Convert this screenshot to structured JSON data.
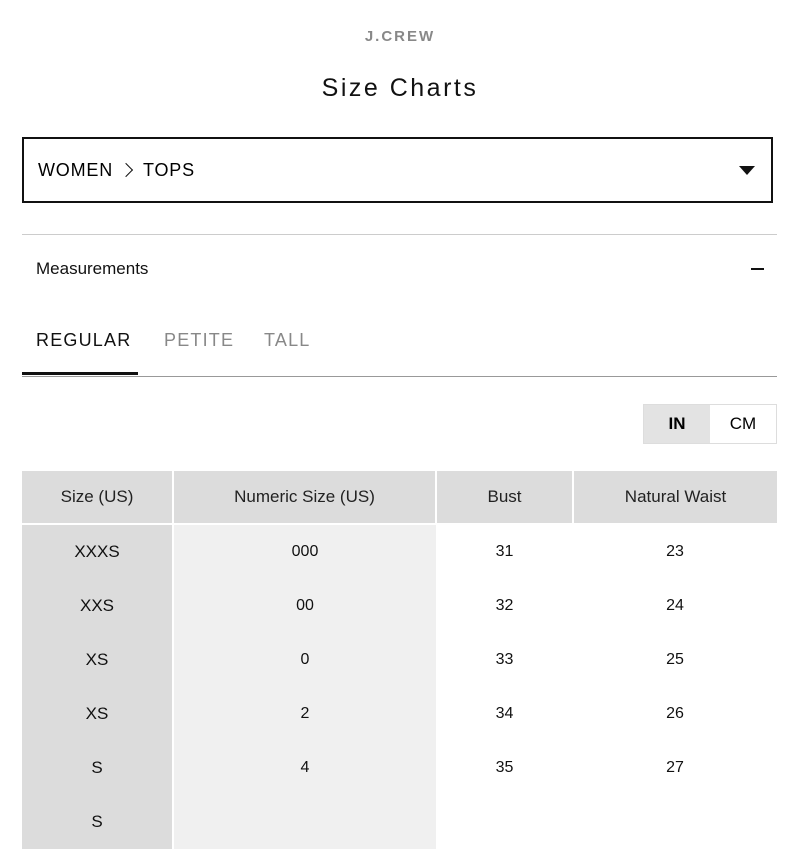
{
  "brand": "J.CREW",
  "page_title": "Size Charts",
  "category": {
    "level1": "WOMEN",
    "level2": "TOPS"
  },
  "accordion": {
    "label": "Measurements"
  },
  "tabs": [
    {
      "label": "REGULAR",
      "active": true
    },
    {
      "label": "PETITE",
      "active": false
    },
    {
      "label": "TALL",
      "active": false
    }
  ],
  "units": {
    "in_label": "IN",
    "cm_label": "CM",
    "selected": "IN"
  },
  "table": {
    "headers": [
      "Size (US)",
      "Numeric Size (US)",
      "Bust",
      "Natural Waist"
    ],
    "rows": [
      [
        "XXXS",
        "000",
        "31",
        "23"
      ],
      [
        "XXS",
        "00",
        "32",
        "24"
      ],
      [
        "XS",
        "0",
        "33",
        "25"
      ],
      [
        "XS",
        "2",
        "34",
        "26"
      ],
      [
        "S",
        "4",
        "35",
        "27"
      ],
      [
        "S",
        "",
        "",
        ""
      ]
    ]
  },
  "icons": {
    "breadcrumb_separator": "chevron-right-icon",
    "dropdown": "caret-down-icon",
    "accordion_toggle": "minus-icon"
  }
}
